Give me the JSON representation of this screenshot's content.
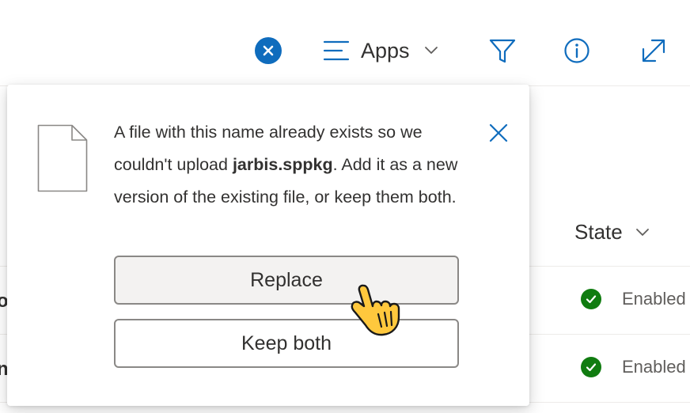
{
  "toolbar": {
    "clear_icon": "close-circle-icon",
    "view_icon": "list-icon",
    "view_label": "Apps",
    "filter_icon": "filter-icon",
    "info_icon": "info-icon",
    "expand_icon": "expand-icon"
  },
  "list": {
    "state_header": "State",
    "rows": [
      {
        "name_fragment": "o",
        "status": "Enabled"
      },
      {
        "name_fragment": "n",
        "status": "Enabled"
      }
    ]
  },
  "dialog": {
    "message_before": "A file with this name already exists so we couldn't upload ",
    "filename": "jarbis.sppkg",
    "message_after": ". Add it as a new version of the existing file, or keep them both.",
    "replace_label": "Replace",
    "keep_both_label": "Keep both"
  },
  "colors": {
    "accent": "#0f6cbd",
    "success": "#107c10",
    "cursor": "#ffc83d"
  }
}
